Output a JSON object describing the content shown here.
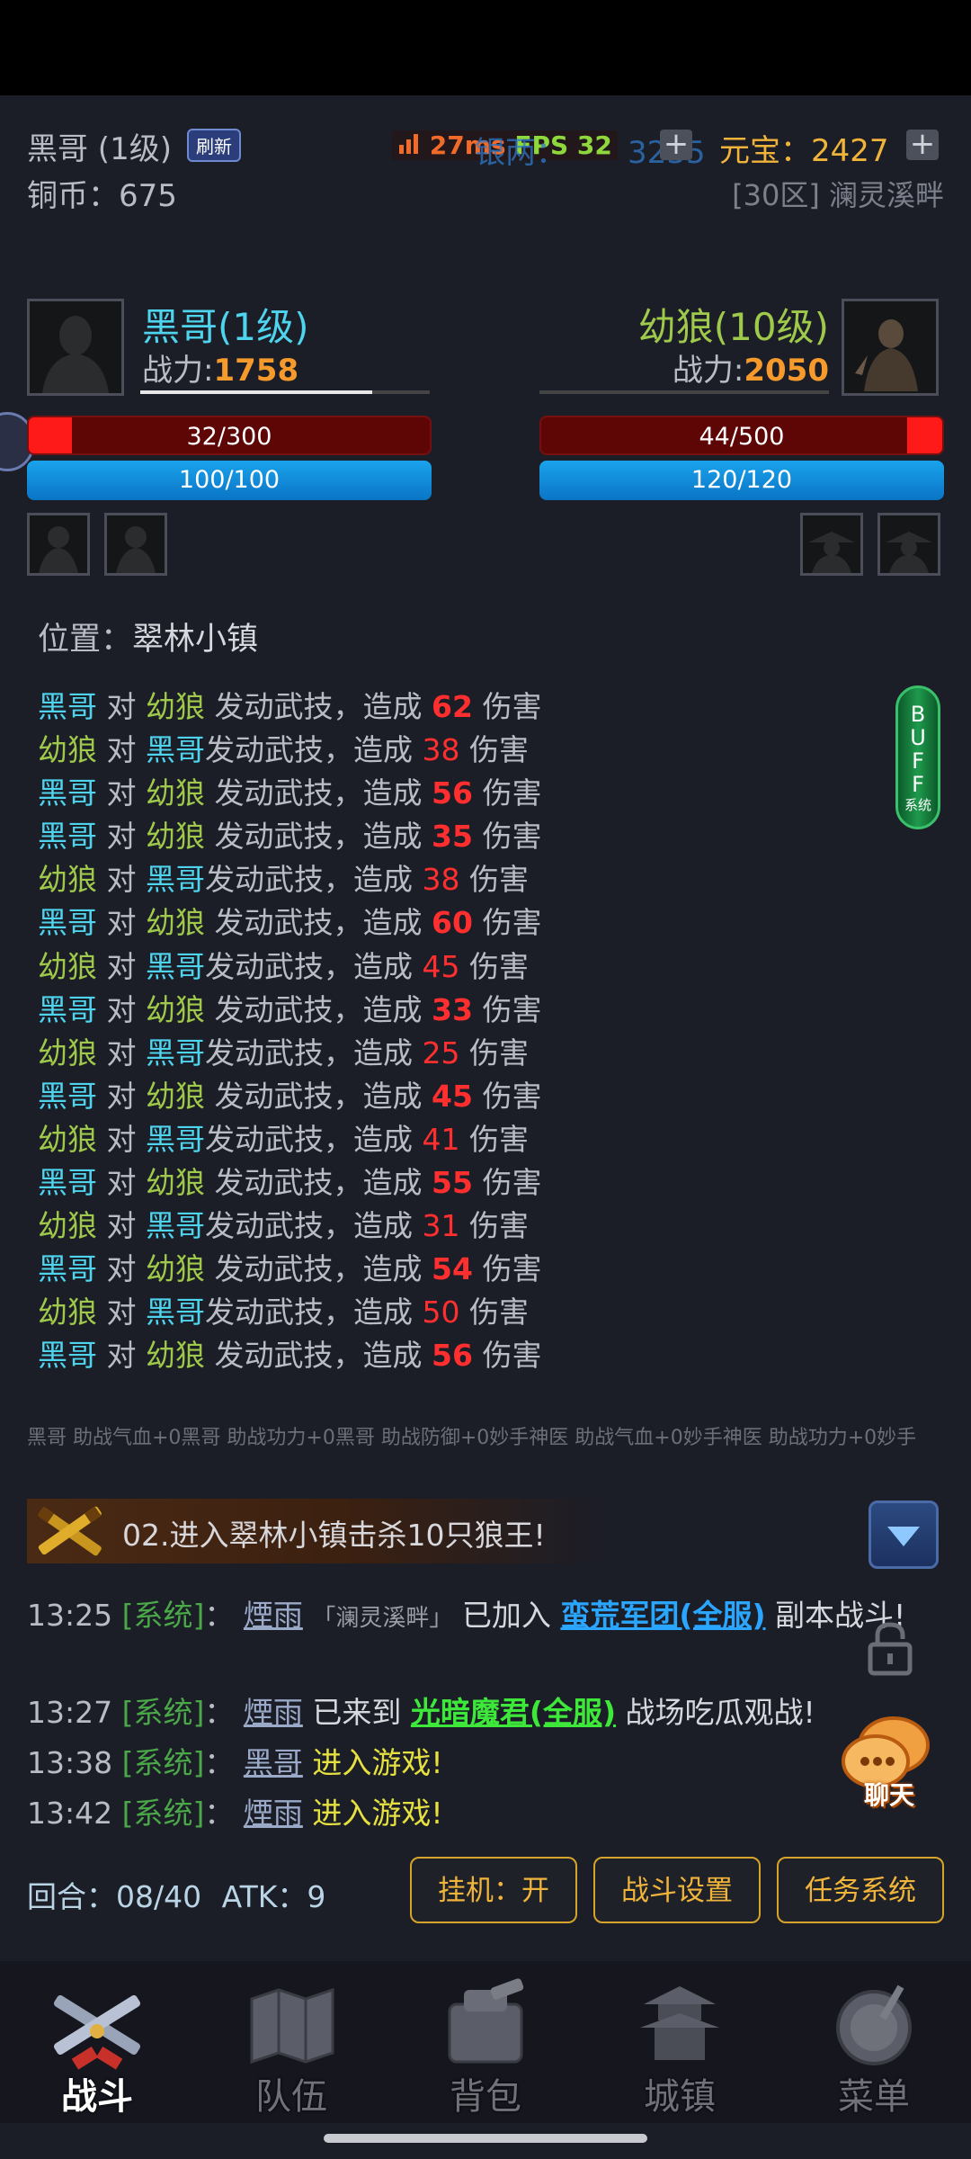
{
  "status_overlay": {
    "ping": "27ms",
    "fps": "FPS 32"
  },
  "header": {
    "player_name_level": "黑哥 (1级)",
    "refresh_badge": "刷新",
    "silver_label": "银两：",
    "silver_value": "3235",
    "yuanbao_label": "元宝：",
    "yuanbao_value": "2427",
    "copper_label": "铜币：",
    "copper_value": "675",
    "server": "[30区] 澜灵溪畔"
  },
  "battle": {
    "player": {
      "name": "黑哥(1级)",
      "power_label": "战力:",
      "power": "1758",
      "hp_text": "32/300",
      "hp_fraction": 0.107,
      "mp_text": "100/100"
    },
    "enemy": {
      "name": "幼狼(10级)",
      "power_label": "战力:",
      "power": "2050",
      "hp_text": "44/500",
      "hp_fraction": 0.088,
      "mp_text": "120/120"
    }
  },
  "location": {
    "label": "位置：",
    "name": "翠林小镇"
  },
  "buff_button": {
    "letters": [
      "B",
      "U",
      "F",
      "F"
    ],
    "sub": "系统"
  },
  "log_text": {
    "vs": "对",
    "action": "发动武技，造成",
    "damage": "伤害"
  },
  "battle_log": [
    {
      "attacker": "黑哥",
      "target": "幼狼",
      "damage": "62"
    },
    {
      "attacker": "幼狼",
      "target": "黑哥",
      "damage": "38"
    },
    {
      "attacker": "黑哥",
      "target": "幼狼",
      "damage": "56"
    },
    {
      "attacker": "黑哥",
      "target": "幼狼",
      "damage": "35"
    },
    {
      "attacker": "幼狼",
      "target": "黑哥",
      "damage": "38"
    },
    {
      "attacker": "黑哥",
      "target": "幼狼",
      "damage": "60"
    },
    {
      "attacker": "幼狼",
      "target": "黑哥",
      "damage": "45"
    },
    {
      "attacker": "黑哥",
      "target": "幼狼",
      "damage": "33"
    },
    {
      "attacker": "幼狼",
      "target": "黑哥",
      "damage": "25"
    },
    {
      "attacker": "黑哥",
      "target": "幼狼",
      "damage": "45"
    },
    {
      "attacker": "幼狼",
      "target": "黑哥",
      "damage": "41"
    },
    {
      "attacker": "黑哥",
      "target": "幼狼",
      "damage": "55"
    },
    {
      "attacker": "幼狼",
      "target": "黑哥",
      "damage": "31"
    },
    {
      "attacker": "黑哥",
      "target": "幼狼",
      "damage": "54"
    },
    {
      "attacker": "幼狼",
      "target": "黑哥",
      "damage": "50"
    },
    {
      "attacker": "黑哥",
      "target": "幼狼",
      "damage": "56"
    }
  ],
  "assist_ticker": "黑哥 助战气血+0黑哥 助战功力+0黑哥 助战防御+0妙手神医 助战气血+0妙手神医 助战功力+0妙手",
  "quest": {
    "text": "02.进入翠林小镇击杀10只狼王!"
  },
  "chat": {
    "sys_tag": "[系统]",
    "messages": [
      {
        "time": "13:25",
        "user": "煙雨",
        "server_tag": "「澜灵溪畔」",
        "pre": "已加入",
        "link": "蛮荒军团(全服)",
        "post": "副本战斗!"
      },
      {
        "time": "13:27",
        "user": "煙雨",
        "pre": "已来到",
        "link": "光暗魔君(全服)",
        "post": "战场吃瓜观战!"
      },
      {
        "time": "13:38",
        "user": "黑哥",
        "text": "进入游戏!"
      },
      {
        "time": "13:42",
        "user": "煙雨",
        "text": "进入游戏!"
      }
    ],
    "chat_button": "聊天"
  },
  "footer": {
    "round_label": "回合：",
    "round_value": "08/40",
    "atk_label": "ATK：",
    "atk_value": "9",
    "auto_button": "挂机：开",
    "settings_button": "战斗设置",
    "quest_button": "任务系统"
  },
  "nav": [
    {
      "label": "战斗",
      "icon": "crossed-swords-icon",
      "active": true
    },
    {
      "label": "队伍",
      "icon": "scroll-map-icon",
      "active": false
    },
    {
      "label": "背包",
      "icon": "backpack-icon",
      "active": false
    },
    {
      "label": "城镇",
      "icon": "pagoda-icon",
      "active": false
    },
    {
      "label": "菜单",
      "icon": "drum-icon",
      "active": false
    }
  ]
}
